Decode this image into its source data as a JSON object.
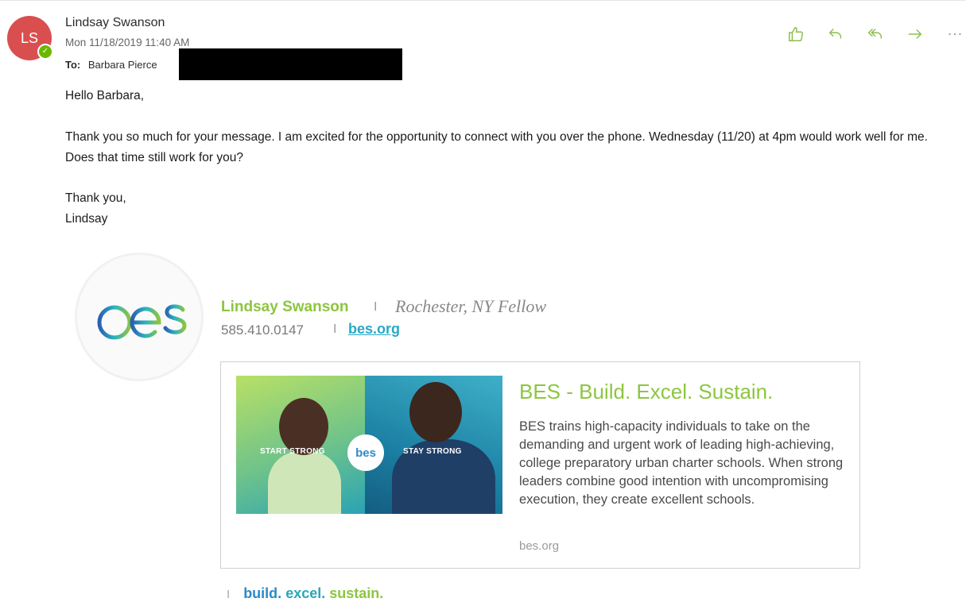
{
  "header": {
    "avatar_initials": "LS",
    "presence_symbol": "✓",
    "sender_name": "Lindsay Swanson",
    "date": "Mon 11/18/2019 11:40 AM",
    "to_label": "To:",
    "to_name": "Barbara Pierce",
    "actions": [
      "like",
      "reply",
      "reply-all",
      "forward",
      "more"
    ]
  },
  "message": {
    "greeting": "Hello Barbara,",
    "paragraph": "Thank you so much for your message. I am excited for the opportunity to connect with you over the phone. Wednesday (11/20) at 4pm would work well for me. Does that time still work for you?",
    "closing_line1": "Thank you,",
    "closing_line2": "Lindsay"
  },
  "signature": {
    "logo_text": "bes",
    "name": "Lindsay Swanson",
    "separator": "I",
    "title": "Rochester, NY Fellow",
    "phone": "585.410.0147",
    "link_text": "bes.org",
    "card": {
      "image_text_left": "START STRONG",
      "image_text_right": "STAY STRONG",
      "image_logo": "bes",
      "title": "BES - Build. Excel. Sustain.",
      "description": "BES trains high-capacity individuals to take on the demanding and urgent work of leading high-achieving, college preparatory urban charter schools. When strong leaders combine good intention with uncompromising execution, they create excellent schools.",
      "domain": "bes.org"
    },
    "tagline": {
      "separator": "I",
      "word1": "build.",
      "word2": "excel.",
      "word3": "sustain."
    }
  },
  "colors": {
    "accent_green": "#8cc63f",
    "link_teal": "#29a8c7",
    "avatar_red": "#d94f4f",
    "presence_green": "#6bb700"
  }
}
